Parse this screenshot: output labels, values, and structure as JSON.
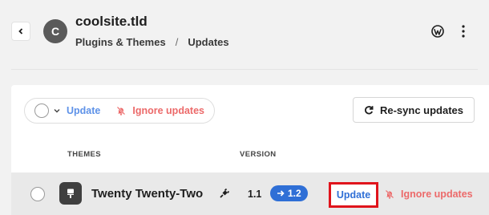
{
  "header": {
    "avatar_letter": "C",
    "site_title": "coolsite.tld",
    "breadcrumb": {
      "parent": "Plugins & Themes",
      "separator": "/",
      "current": "Updates"
    },
    "icons": {
      "back": "chevron-left-icon",
      "platform": "wordpress-icon",
      "menu": "more-vertical-icon"
    }
  },
  "toolbar": {
    "update_label": "Update",
    "ignore_label": "Ignore updates",
    "resync_label": "Re-sync updates"
  },
  "table": {
    "columns": [
      "THEMES",
      "VERSION"
    ],
    "rows": [
      {
        "name": "Twenty Twenty-Two",
        "current_version": "1.1",
        "new_version": "1.2",
        "update_label": "Update",
        "ignore_label": "Ignore updates"
      }
    ]
  },
  "colors": {
    "link_blue": "#5e92e8",
    "accent_blue": "#2f6fd6",
    "danger_red": "#ec6a6a",
    "highlight_red": "#e0141c"
  }
}
